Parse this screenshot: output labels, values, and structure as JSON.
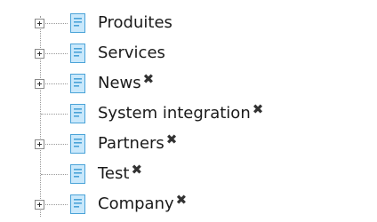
{
  "tree": {
    "nodes": [
      {
        "label": "Produites",
        "expandable": true,
        "deletable": false,
        "delete_glyph": "✖"
      },
      {
        "label": "Services",
        "expandable": true,
        "deletable": false,
        "delete_glyph": "✖"
      },
      {
        "label": "News",
        "expandable": true,
        "deletable": true,
        "delete_glyph": "✖"
      },
      {
        "label": "System integration",
        "expandable": false,
        "deletable": true,
        "delete_glyph": "✖"
      },
      {
        "label": "Partners",
        "expandable": true,
        "deletable": true,
        "delete_glyph": "✖"
      },
      {
        "label": "Test",
        "expandable": false,
        "deletable": true,
        "delete_glyph": "✖"
      },
      {
        "label": "Company",
        "expandable": true,
        "deletable": true,
        "delete_glyph": "✖"
      }
    ],
    "icons": {
      "expander": "plus-box-icon",
      "page": "page-icon",
      "delete": "close-icon"
    },
    "colors": {
      "page_icon_fill": "#c9e8fb",
      "page_icon_border": "#4aa3d8",
      "text": "#1a1a1a",
      "connector": "#9a9a9a"
    }
  }
}
